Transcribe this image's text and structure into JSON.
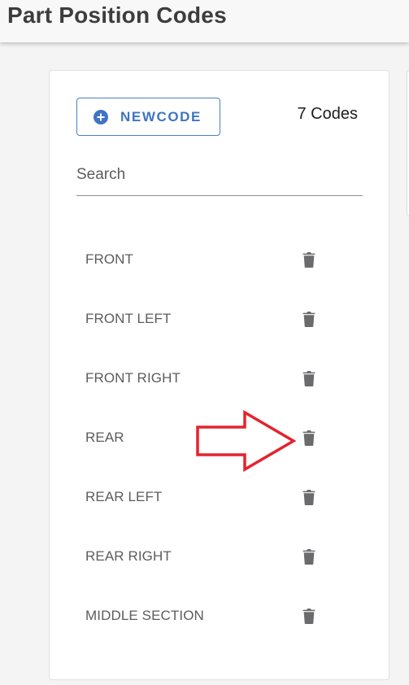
{
  "header": {
    "title": "Part Position Codes"
  },
  "toolbar": {
    "new_code_label": "NEWCODE",
    "count_label": "7 Codes"
  },
  "search": {
    "placeholder": "Search",
    "value": ""
  },
  "codes": [
    {
      "label": "FRONT"
    },
    {
      "label": "FRONT LEFT"
    },
    {
      "label": "FRONT RIGHT"
    },
    {
      "label": "REAR"
    },
    {
      "label": "REAR LEFT"
    },
    {
      "label": "REAR RIGHT"
    },
    {
      "label": "MIDDLE SECTION"
    }
  ],
  "icons": {
    "new_code": "plus-circle-icon",
    "delete": "trash-icon",
    "annotation": "arrow-right-outline"
  },
  "colors": {
    "accent": "#3f74c2",
    "trash": "#6b6b6e",
    "annotation_arrow": "#e3232e"
  }
}
